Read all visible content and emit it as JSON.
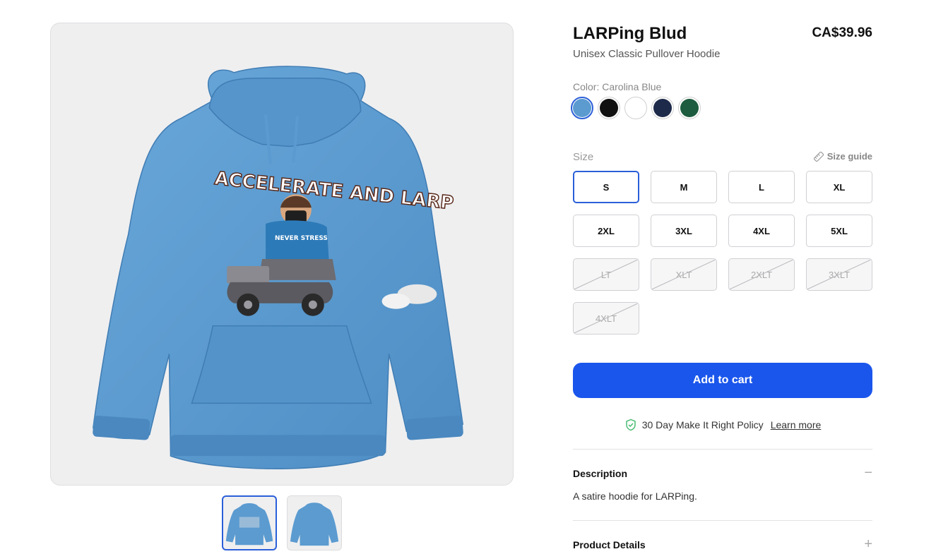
{
  "product": {
    "title": "LARPing Blud",
    "price": "CA$39.96",
    "subtitle": "Unisex Classic Pullover Hoodie"
  },
  "artwork": {
    "headline": "ACCELERATE AND LARP",
    "shirt_text": "NEVER STRESS"
  },
  "color": {
    "label": "Color: Carolina Blue",
    "swatches": [
      {
        "name": "carolina-blue",
        "hex": "#5b9bd0",
        "selected": true
      },
      {
        "name": "black",
        "hex": "#111111",
        "selected": false
      },
      {
        "name": "white",
        "hex": "#ffffff",
        "selected": false
      },
      {
        "name": "navy",
        "hex": "#1e2a4a",
        "selected": false
      },
      {
        "name": "forest-green",
        "hex": "#1d5c3e",
        "selected": false
      }
    ]
  },
  "size": {
    "label": "Size",
    "guide_label": "Size guide",
    "options": [
      {
        "label": "S",
        "selected": true,
        "available": true
      },
      {
        "label": "M",
        "selected": false,
        "available": true
      },
      {
        "label": "L",
        "selected": false,
        "available": true
      },
      {
        "label": "XL",
        "selected": false,
        "available": true
      },
      {
        "label": "2XL",
        "selected": false,
        "available": true
      },
      {
        "label": "3XL",
        "selected": false,
        "available": true
      },
      {
        "label": "4XL",
        "selected": false,
        "available": true
      },
      {
        "label": "5XL",
        "selected": false,
        "available": true
      },
      {
        "label": "LT",
        "selected": false,
        "available": false
      },
      {
        "label": "XLT",
        "selected": false,
        "available": false
      },
      {
        "label": "2XLT",
        "selected": false,
        "available": false
      },
      {
        "label": "3XLT",
        "selected": false,
        "available": false
      },
      {
        "label": "4XLT",
        "selected": false,
        "available": false
      }
    ]
  },
  "cart": {
    "add_label": "Add to cart"
  },
  "policy": {
    "text": "30 Day Make It Right Policy",
    "link": "Learn more"
  },
  "description": {
    "title": "Description",
    "toggle": "−",
    "text": "A satire hoodie for LARPing."
  },
  "details": {
    "title": "Product Details",
    "toggle": "+"
  },
  "colors": {
    "accent": "#1a56ec",
    "selected_border": "#2b5fd9",
    "hoodie": "#5b9bd0",
    "shield": "#3fb86b"
  }
}
